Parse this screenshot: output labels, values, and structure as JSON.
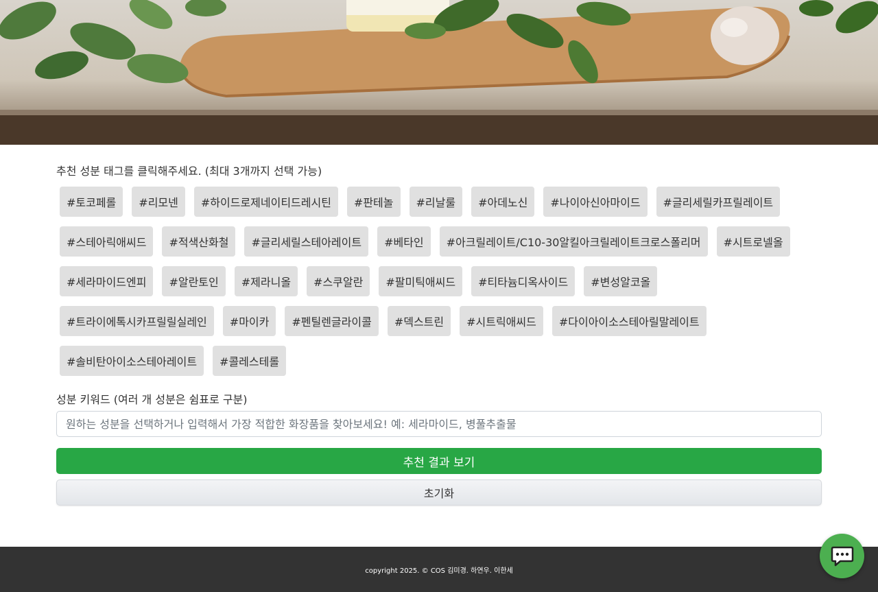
{
  "hero": {
    "image": "herbs-wooden-board-photo"
  },
  "tags_section": {
    "prompt": "추천 성분 태그를 클릭해주세요. (최대 3개까지 선택 가능)",
    "tags": [
      "#토코페롤",
      "#리모넨",
      "#하이드로제네이티드레시틴",
      "#판테놀",
      "#리날룰",
      "#아데노신",
      "#나이아신아마이드",
      "#글리세릴카프릴레이트",
      "#스테아릭애씨드",
      "#적색산화철",
      "#글리세릴스테아레이트",
      "#베타인",
      "#아크릴레이트/C10-30알킬아크릴레이트크로스폴리머",
      "#시트로넬올",
      "#세라마이드엔피",
      "#알란토인",
      "#제라니올",
      "#스쿠알란",
      "#팔미틱애씨드",
      "#티타늄디옥사이드",
      "#변성알코올",
      "#트라이에톡시카프릴릴실레인",
      "#마이카",
      "#펜틸렌글라이콜",
      "#덱스트린",
      "#시트릭애씨드",
      "#다이아이소스테아릴말레이트",
      "#솔비탄아이소스테아레이트",
      "#콜레스테롤"
    ]
  },
  "keyword": {
    "label": "성분 키워드 (여러 개 성분은 쉼표로 구분)",
    "placeholder": "원하는 성분을 선택하거나 입력해서 가장 적합한 화장품을 찾아보세요! 예: 세라마이드, 병풀추출물",
    "value": ""
  },
  "buttons": {
    "submit_label": "추천 결과 보기",
    "reset_label": "초기화"
  },
  "footer": {
    "text": "copyright 2025. © COS 김미경. 하연우. 이한세"
  },
  "chat": {
    "icon": "chat-bubble-icon"
  },
  "colors": {
    "primary_button": "#28a745",
    "tag_background": "#e0e0e0",
    "footer_background": "#333333",
    "chat_button": "#4caf50"
  }
}
